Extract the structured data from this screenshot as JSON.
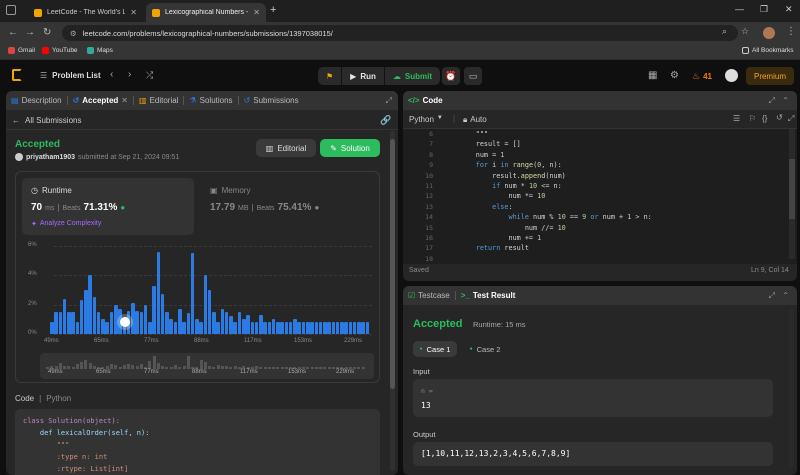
{
  "browser": {
    "tabs": [
      {
        "title": "LeetCode - The World's Leadin",
        "active": false
      },
      {
        "title": "Lexicographical Numbers - Leet",
        "active": true
      }
    ],
    "url": "leetcode.com/problems/lexicographical-numbers/submissions/1397038015/",
    "bookmarks": [
      "Gmail",
      "YouTube",
      "Maps"
    ],
    "all_bookmarks": "All Bookmarks"
  },
  "nav": {
    "problem_list": "Problem List",
    "run": "Run",
    "submit": "Submit",
    "streak": "41",
    "premium": "Premium"
  },
  "left": {
    "tabs": [
      "Description",
      "Accepted",
      "Editorial",
      "Solutions",
      "Submissions"
    ],
    "back": "All Submissions",
    "status": "Accepted",
    "user": "priyatham1903",
    "submitted": "submitted at Sep 21, 2024 09:51",
    "editorial_btn": "Editorial",
    "solution_btn": "Solution",
    "runtime": {
      "label": "Runtime",
      "value": "70",
      "unit": "ms",
      "beats_label": "Beats",
      "beats": "71.31%"
    },
    "memory": {
      "label": "Memory",
      "value": "17.79",
      "unit": "MB",
      "beats_label": "Beats",
      "beats": "75.41%"
    },
    "analyze": "Analyze Complexity",
    "code_label": "Code",
    "lang": "Python",
    "code_lines": [
      "class Solution(object):",
      "    def lexicalOrder(self, n):",
      "        \"\"\"",
      "        :type n: int",
      "        :rtype: List[int]"
    ]
  },
  "chart_data": {
    "type": "bar",
    "yticks": [
      "6%",
      "4%",
      "2%",
      "0%"
    ],
    "ylim": [
      0,
      6
    ],
    "xticks": [
      "49ms",
      "65ms",
      "77ms",
      "88ms",
      "117ms",
      "153ms",
      "229ms"
    ],
    "values": [
      0.8,
      1.5,
      1.5,
      2.4,
      1.5,
      1.5,
      0.8,
      2.3,
      3.0,
      4.0,
      2.5,
      1.5,
      1.0,
      0.8,
      1.5,
      2.0,
      1.7,
      0.8,
      1.6,
      2.1,
      1.6,
      1.5,
      2.0,
      0.8,
      3.3,
      5.6,
      2.7,
      1.5,
      1.0,
      0.8,
      1.7,
      0.8,
      1.4,
      5.5,
      1.0,
      0.8,
      4.0,
      3.0,
      1.5,
      0.8,
      1.7,
      1.5,
      1.2,
      0.8,
      1.5,
      1.0,
      1.3,
      0.8,
      0.8,
      1.3,
      0.8,
      0.8,
      1.0,
      0.8,
      0.8,
      0.8,
      0.8,
      1.0,
      0.8,
      0.8,
      0.8,
      0.8,
      0.8,
      0.8,
      0.8,
      0.8,
      0.8,
      0.8,
      0.8,
      0.8,
      0.8,
      0.8,
      0.8,
      0.8,
      0.8
    ],
    "highlight_index": 17,
    "mini_xticks": [
      "49ms",
      "65ms",
      "77ms",
      "88ms",
      "117ms",
      "153ms",
      "229ms"
    ]
  },
  "code": {
    "title": "Code",
    "lang": "Python",
    "mode": "Auto",
    "line_numbers": [
      "6",
      "7",
      "8",
      "9",
      "10",
      "11",
      "12",
      "13",
      "14",
      "15",
      "16",
      "17",
      "18"
    ],
    "lines": [
      "        \"\"\"",
      "        result = []",
      "        num = 1",
      "        for i in range(0, n):",
      "            result.append(num)",
      "            if num * 10 <= n:",
      "                num *= 10",
      "            else:",
      "                while num % 10 == 9 or num + 1 > n:",
      "                    num //= 10",
      "                num += 1",
      "        return result",
      ""
    ],
    "status": "Saved",
    "cursor": "Ln 9, Col 14"
  },
  "test": {
    "tabs": [
      "Testcase",
      "Test Result"
    ],
    "status": "Accepted",
    "runtime": "Runtime: 15 ms",
    "cases": [
      "Case 1",
      "Case 2"
    ],
    "input_label": "Input",
    "var": "n =",
    "input": "13",
    "output_label": "Output",
    "output": "[1,10,11,12,13,2,3,4,5,6,7,8,9]"
  }
}
